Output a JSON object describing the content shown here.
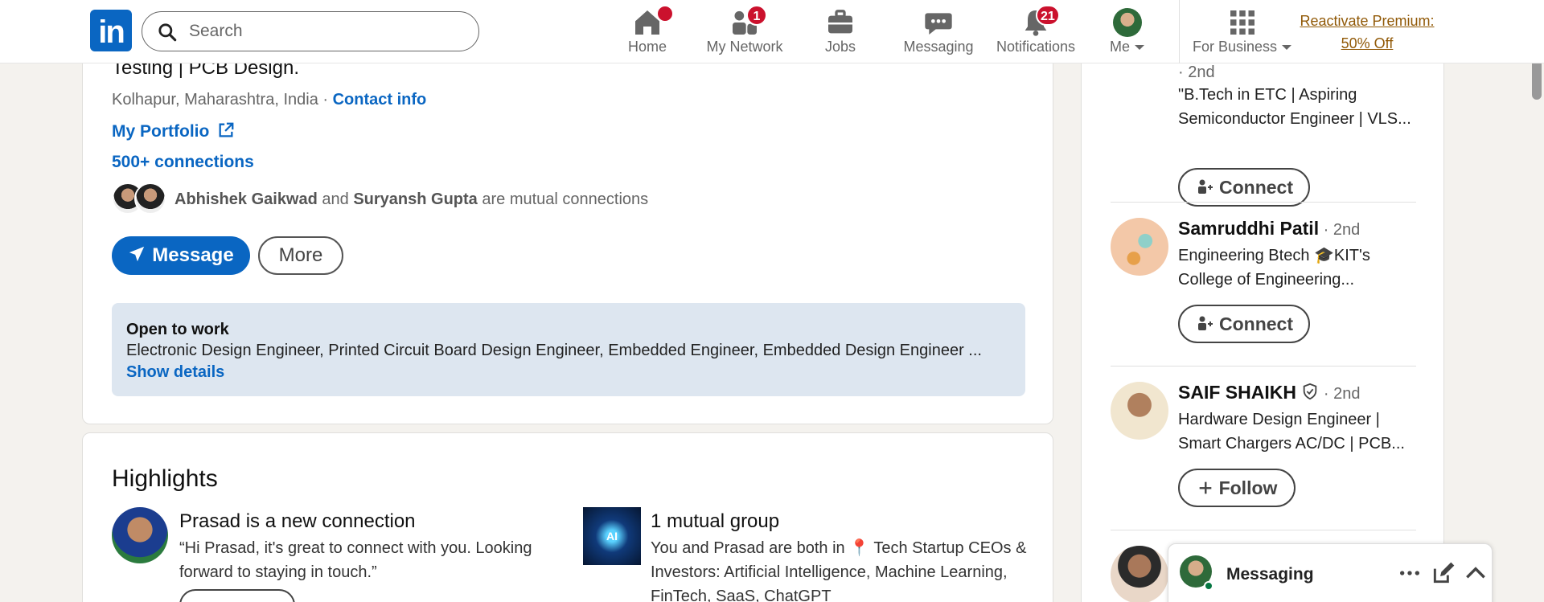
{
  "nav": {
    "logo": "in",
    "search_placeholder": "Search",
    "items": [
      {
        "label": "Home",
        "badge": ""
      },
      {
        "label": "My Network",
        "badge": "1"
      },
      {
        "label": "Jobs",
        "badge": ""
      },
      {
        "label": "Messaging",
        "badge": ""
      },
      {
        "label": "Notifications",
        "badge": "21"
      },
      {
        "label": "Me",
        "badge": ""
      },
      {
        "label": "For Business",
        "badge": ""
      }
    ],
    "premium_line1": "Reactivate Premium:",
    "premium_line2": "50% Off"
  },
  "profile": {
    "headline": "Testing | PCB Design.",
    "location": "Kolhapur, Maharashtra, India · ",
    "contact_info": "Contact info",
    "portfolio": "My Portfolio",
    "connections": "500+ connections",
    "mutual_name1": "Abhishek Gaikwad",
    "mutual_and": " and ",
    "mutual_name2": "Suryansh Gupta",
    "mutual_suffix": " are mutual connections",
    "message_btn": "Message",
    "more_btn": "More",
    "open_to_work": {
      "title": "Open to work",
      "roles": "Electronic Design Engineer, Printed Circuit Board Design Engineer, Embedded Engineer, Embedded Design Engineer ...",
      "link": "Show details"
    }
  },
  "highlights": {
    "title": "Highlights",
    "items": [
      {
        "heading": "Prasad is a new connection",
        "body": "“Hi Prasad, it's great to connect with you. Looking forward to staying in touch.”"
      },
      {
        "heading": "1 mutual group",
        "body": "You and Prasad are both in 📍 Tech Startup CEOs & Investors: Artificial Intelligence, Machine Learning, FinTech, SaaS, ChatGPT",
        "thumb_label": "AI"
      }
    ]
  },
  "sidebar": {
    "people": [
      {
        "name": "",
        "degree": "· 2nd",
        "headline": "\"B.Tech in ETC | Aspiring Semiconductor Engineer | VLS...",
        "action": "Connect"
      },
      {
        "name": "Samruddhi Patil",
        "degree": " · 2nd",
        "headline": "Engineering Btech 🎓KIT's College of Engineering...",
        "action": "Connect"
      },
      {
        "name": "SAIF SHAIKH",
        "degree": " · 2nd",
        "headline": "Hardware Design Engineer | Smart Chargers AC/DC | PCB...",
        "action": "Follow"
      }
    ]
  },
  "messaging_popup": {
    "label": "Messaging"
  },
  "colors": {
    "brand": "#0a66c2",
    "badge": "#cb112d",
    "premium": "#915907",
    "open_to_work_bg": "#dde6f0"
  }
}
